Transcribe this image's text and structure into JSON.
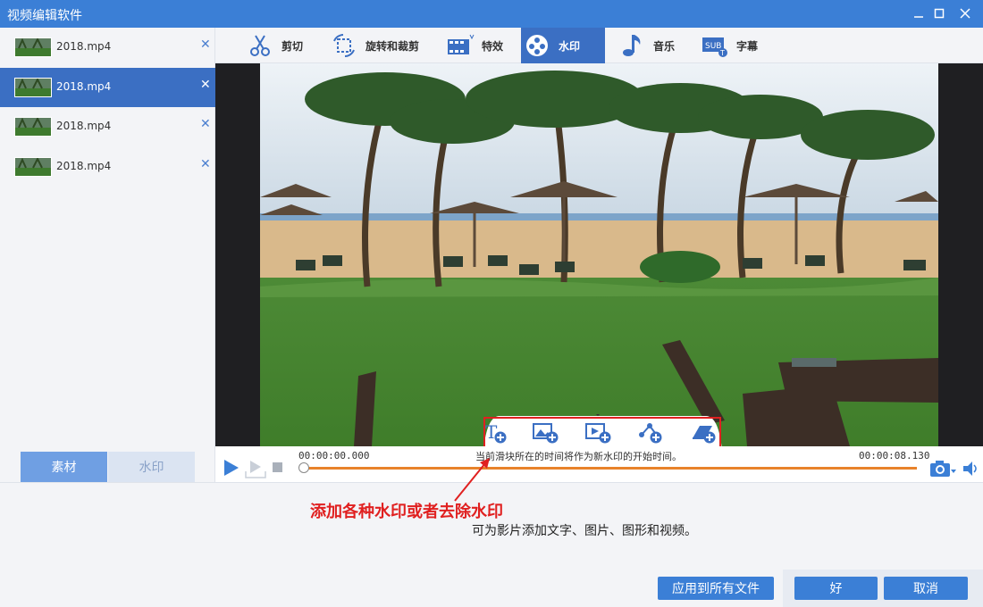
{
  "window": {
    "title": "视频编辑软件"
  },
  "files": [
    {
      "name": "2018.mp4",
      "selected": false
    },
    {
      "name": "2018.mp4",
      "selected": true
    },
    {
      "name": "2018.mp4",
      "selected": false
    },
    {
      "name": "2018.mp4",
      "selected": false
    }
  ],
  "side_tabs": {
    "material": "素材",
    "watermark": "水印"
  },
  "tools": [
    {
      "label": "剪切",
      "icon": "scissors-icon"
    },
    {
      "label": "旋转和裁剪",
      "icon": "rotate-crop-icon"
    },
    {
      "label": "特效",
      "icon": "effects-icon"
    },
    {
      "label": "水印",
      "icon": "watermark-icon",
      "active": true
    },
    {
      "label": "音乐",
      "icon": "music-note-icon"
    },
    {
      "label": "字幕",
      "icon": "subtitle-icon"
    }
  ],
  "watermark_tools": [
    {
      "icon": "add-text-watermark-icon"
    },
    {
      "icon": "add-image-watermark-icon"
    },
    {
      "icon": "add-video-watermark-icon"
    },
    {
      "icon": "add-shape-watermark-icon"
    },
    {
      "icon": "remove-watermark-icon"
    }
  ],
  "player": {
    "current_time": "00:00:00.000",
    "end_time": "00:00:08.130",
    "hint": "当前滑块所在的时间将作为新水印的开始时间。",
    "progress": 0.0
  },
  "annotation": "添加各种水印或者去除水印",
  "description": "可为影片添加文字、图片、图形和视频。",
  "buttons": {
    "apply_all": "应用到所有文件",
    "ok": "好",
    "cancel": "取消"
  },
  "colors": {
    "accent": "#3b7fd6",
    "selected": "#3b6fc3",
    "timeline": "#e8822a",
    "annotation": "#e02020"
  }
}
